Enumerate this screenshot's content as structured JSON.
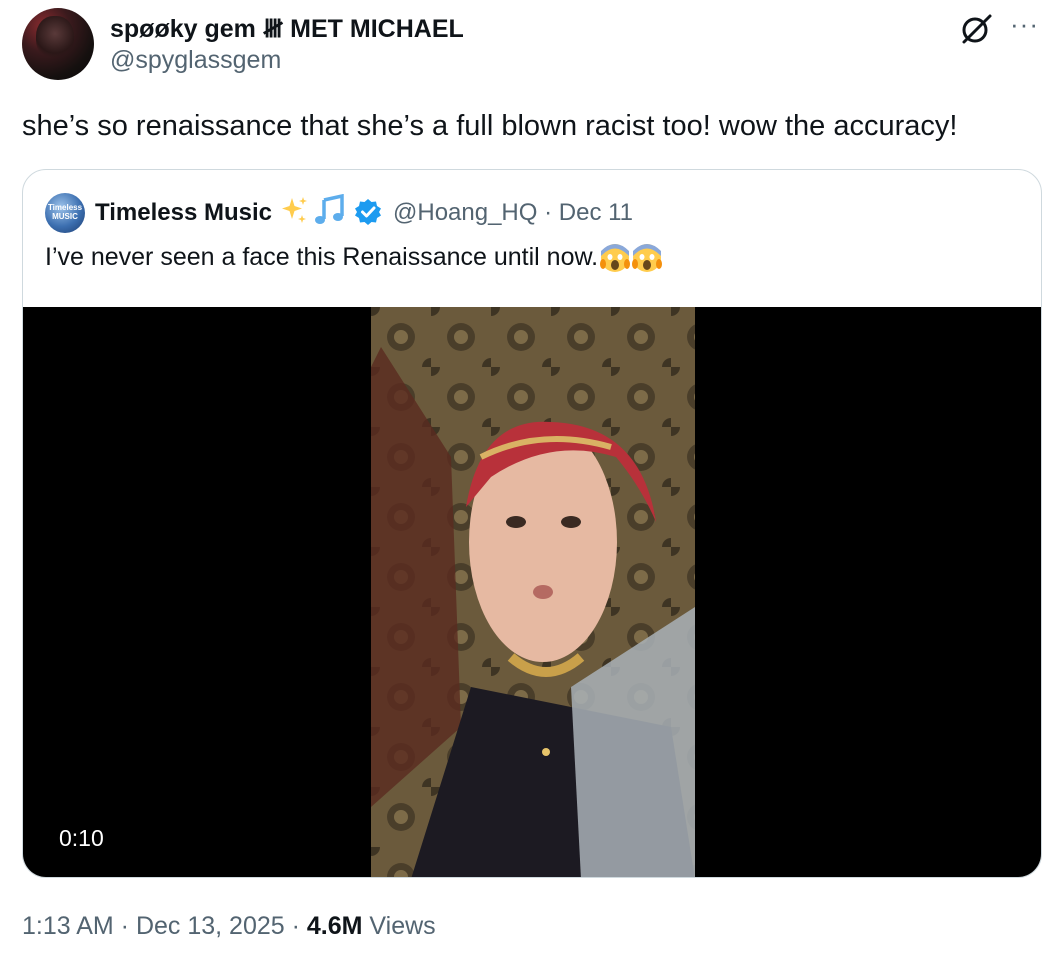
{
  "author": {
    "display_name": "spøøky gem 𝍸 MET MICHAEL",
    "handle": "@spyglassgem"
  },
  "tweet": {
    "text": "she’s so renaissance that she’s a full blown racist too! wow the accuracy!"
  },
  "quoted_tweet": {
    "avatar_text": "Timeless MUSIC",
    "display_name": "Timeless Music",
    "handle_date": "@Hoang_HQ · Dec 11",
    "text": "I’ve never seen a face this Renaissance until now.",
    "video_duration": "0:10"
  },
  "meta": {
    "time": "1:13 AM",
    "sep1": " · ",
    "date": "Dec 13, 2025",
    "sep2": " · ",
    "views_count": "4.6M",
    "views_label": " Views"
  },
  "icons": {
    "grok": "grok-icon",
    "more": "more-icon",
    "verified": "verified-badge-icon"
  },
  "colors": {
    "text": "#0f1419",
    "secondary": "#536471",
    "border": "#cfd9de",
    "verified": "#1d9bf0",
    "sparkle": "#ffcc4d",
    "note": "#5dadec"
  }
}
